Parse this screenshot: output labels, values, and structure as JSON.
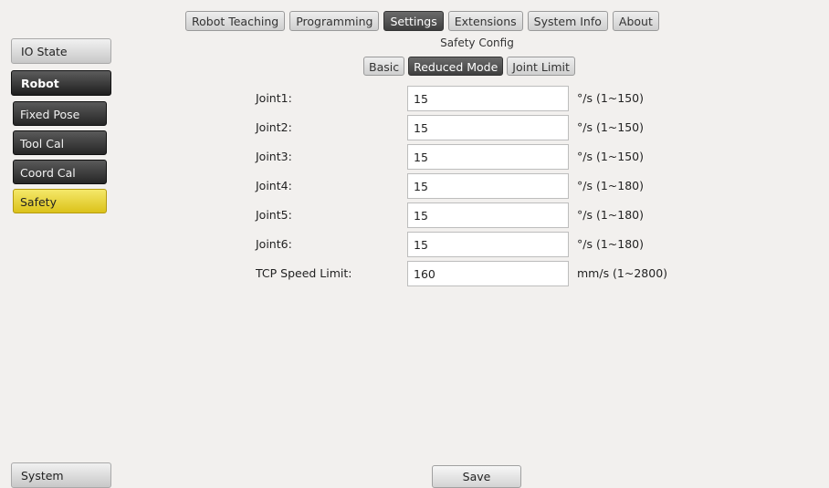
{
  "top_tabs": [
    {
      "label": "Robot Teaching",
      "active": false
    },
    {
      "label": "Programming",
      "active": false
    },
    {
      "label": "Settings",
      "active": true
    },
    {
      "label": "Extensions",
      "active": false
    },
    {
      "label": "System Info",
      "active": false
    },
    {
      "label": "About",
      "active": false
    }
  ],
  "section_title": "Safety Config",
  "sub_tabs": [
    {
      "label": "Basic",
      "active": false
    },
    {
      "label": "Reduced Mode",
      "active": true
    },
    {
      "label": "Joint Limit",
      "active": false
    }
  ],
  "sidebar": {
    "io_state": "IO State",
    "robot": "Robot",
    "items": [
      {
        "label": "Fixed Pose",
        "active": false
      },
      {
        "label": "Tool Cal",
        "active": false
      },
      {
        "label": "Coord Cal",
        "active": false
      },
      {
        "label": "Safety",
        "active": true
      }
    ],
    "system": "System"
  },
  "form": {
    "rows": [
      {
        "label": "Joint1:",
        "value": "15",
        "unit": "°/s (1~150)"
      },
      {
        "label": "Joint2:",
        "value": "15",
        "unit": "°/s (1~150)"
      },
      {
        "label": "Joint3:",
        "value": "15",
        "unit": "°/s (1~150)"
      },
      {
        "label": "Joint4:",
        "value": "15",
        "unit": "°/s (1~180)"
      },
      {
        "label": "Joint5:",
        "value": "15",
        "unit": "°/s (1~180)"
      },
      {
        "label": "Joint6:",
        "value": "15",
        "unit": "°/s (1~180)"
      },
      {
        "label": "TCP Speed Limit:",
        "value": "160",
        "unit": "mm/s (1~2800)"
      }
    ]
  },
  "save_label": "Save",
  "colors": {
    "background": "#f2f0ee",
    "active_dark": "#3f3f3f",
    "selected_yellow": "#e6cf2a"
  }
}
